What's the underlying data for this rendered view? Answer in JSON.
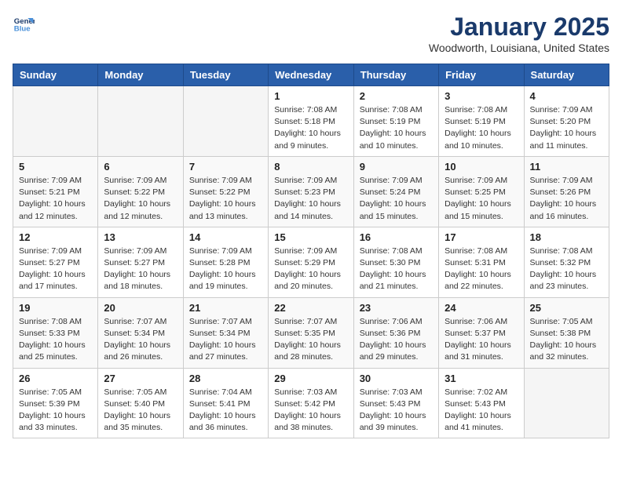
{
  "logo": {
    "line1": "General",
    "line2": "Blue"
  },
  "title": "January 2025",
  "subtitle": "Woodworth, Louisiana, United States",
  "weekdays": [
    "Sunday",
    "Monday",
    "Tuesday",
    "Wednesday",
    "Thursday",
    "Friday",
    "Saturday"
  ],
  "weeks": [
    [
      {
        "day": "",
        "info": ""
      },
      {
        "day": "",
        "info": ""
      },
      {
        "day": "",
        "info": ""
      },
      {
        "day": "1",
        "info": "Sunrise: 7:08 AM\nSunset: 5:18 PM\nDaylight: 10 hours\nand 9 minutes."
      },
      {
        "day": "2",
        "info": "Sunrise: 7:08 AM\nSunset: 5:19 PM\nDaylight: 10 hours\nand 10 minutes."
      },
      {
        "day": "3",
        "info": "Sunrise: 7:08 AM\nSunset: 5:19 PM\nDaylight: 10 hours\nand 10 minutes."
      },
      {
        "day": "4",
        "info": "Sunrise: 7:09 AM\nSunset: 5:20 PM\nDaylight: 10 hours\nand 11 minutes."
      }
    ],
    [
      {
        "day": "5",
        "info": "Sunrise: 7:09 AM\nSunset: 5:21 PM\nDaylight: 10 hours\nand 12 minutes."
      },
      {
        "day": "6",
        "info": "Sunrise: 7:09 AM\nSunset: 5:22 PM\nDaylight: 10 hours\nand 12 minutes."
      },
      {
        "day": "7",
        "info": "Sunrise: 7:09 AM\nSunset: 5:22 PM\nDaylight: 10 hours\nand 13 minutes."
      },
      {
        "day": "8",
        "info": "Sunrise: 7:09 AM\nSunset: 5:23 PM\nDaylight: 10 hours\nand 14 minutes."
      },
      {
        "day": "9",
        "info": "Sunrise: 7:09 AM\nSunset: 5:24 PM\nDaylight: 10 hours\nand 15 minutes."
      },
      {
        "day": "10",
        "info": "Sunrise: 7:09 AM\nSunset: 5:25 PM\nDaylight: 10 hours\nand 15 minutes."
      },
      {
        "day": "11",
        "info": "Sunrise: 7:09 AM\nSunset: 5:26 PM\nDaylight: 10 hours\nand 16 minutes."
      }
    ],
    [
      {
        "day": "12",
        "info": "Sunrise: 7:09 AM\nSunset: 5:27 PM\nDaylight: 10 hours\nand 17 minutes."
      },
      {
        "day": "13",
        "info": "Sunrise: 7:09 AM\nSunset: 5:27 PM\nDaylight: 10 hours\nand 18 minutes."
      },
      {
        "day": "14",
        "info": "Sunrise: 7:09 AM\nSunset: 5:28 PM\nDaylight: 10 hours\nand 19 minutes."
      },
      {
        "day": "15",
        "info": "Sunrise: 7:09 AM\nSunset: 5:29 PM\nDaylight: 10 hours\nand 20 minutes."
      },
      {
        "day": "16",
        "info": "Sunrise: 7:08 AM\nSunset: 5:30 PM\nDaylight: 10 hours\nand 21 minutes."
      },
      {
        "day": "17",
        "info": "Sunrise: 7:08 AM\nSunset: 5:31 PM\nDaylight: 10 hours\nand 22 minutes."
      },
      {
        "day": "18",
        "info": "Sunrise: 7:08 AM\nSunset: 5:32 PM\nDaylight: 10 hours\nand 23 minutes."
      }
    ],
    [
      {
        "day": "19",
        "info": "Sunrise: 7:08 AM\nSunset: 5:33 PM\nDaylight: 10 hours\nand 25 minutes."
      },
      {
        "day": "20",
        "info": "Sunrise: 7:07 AM\nSunset: 5:34 PM\nDaylight: 10 hours\nand 26 minutes."
      },
      {
        "day": "21",
        "info": "Sunrise: 7:07 AM\nSunset: 5:34 PM\nDaylight: 10 hours\nand 27 minutes."
      },
      {
        "day": "22",
        "info": "Sunrise: 7:07 AM\nSunset: 5:35 PM\nDaylight: 10 hours\nand 28 minutes."
      },
      {
        "day": "23",
        "info": "Sunrise: 7:06 AM\nSunset: 5:36 PM\nDaylight: 10 hours\nand 29 minutes."
      },
      {
        "day": "24",
        "info": "Sunrise: 7:06 AM\nSunset: 5:37 PM\nDaylight: 10 hours\nand 31 minutes."
      },
      {
        "day": "25",
        "info": "Sunrise: 7:05 AM\nSunset: 5:38 PM\nDaylight: 10 hours\nand 32 minutes."
      }
    ],
    [
      {
        "day": "26",
        "info": "Sunrise: 7:05 AM\nSunset: 5:39 PM\nDaylight: 10 hours\nand 33 minutes."
      },
      {
        "day": "27",
        "info": "Sunrise: 7:05 AM\nSunset: 5:40 PM\nDaylight: 10 hours\nand 35 minutes."
      },
      {
        "day": "28",
        "info": "Sunrise: 7:04 AM\nSunset: 5:41 PM\nDaylight: 10 hours\nand 36 minutes."
      },
      {
        "day": "29",
        "info": "Sunrise: 7:03 AM\nSunset: 5:42 PM\nDaylight: 10 hours\nand 38 minutes."
      },
      {
        "day": "30",
        "info": "Sunrise: 7:03 AM\nSunset: 5:43 PM\nDaylight: 10 hours\nand 39 minutes."
      },
      {
        "day": "31",
        "info": "Sunrise: 7:02 AM\nSunset: 5:43 PM\nDaylight: 10 hours\nand 41 minutes."
      },
      {
        "day": "",
        "info": ""
      }
    ]
  ]
}
